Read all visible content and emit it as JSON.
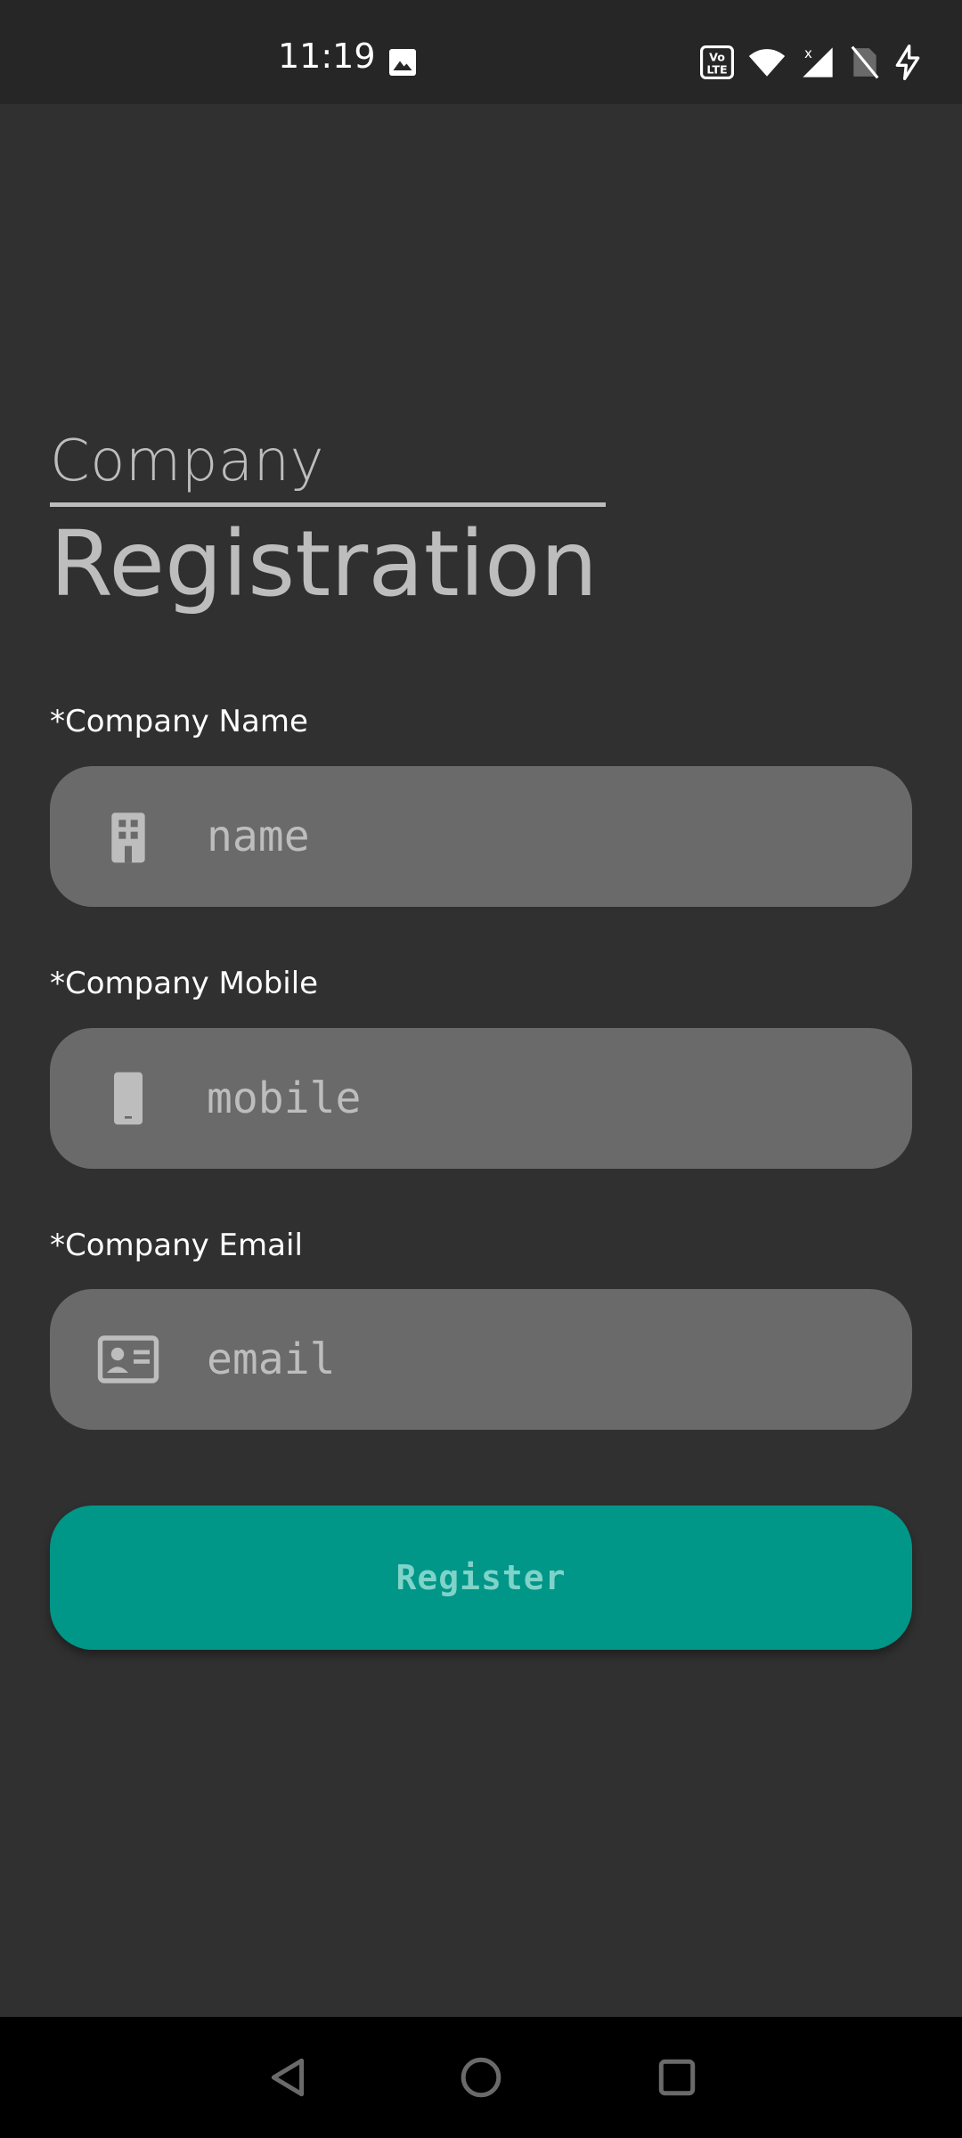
{
  "status_bar": {
    "time": "11:19",
    "icons": [
      "gallery-icon",
      "volte-icon",
      "wifi-icon",
      "signal-icon",
      "no-sim-icon",
      "charging-icon"
    ]
  },
  "header": {
    "title_small": "Company",
    "title_large": "Registration"
  },
  "form": {
    "name": {
      "label": "*Company Name",
      "placeholder": "name",
      "value": "",
      "icon": "building-icon"
    },
    "mobile": {
      "label": "*Company Mobile",
      "placeholder": "mobile",
      "value": "",
      "icon": "phone-icon"
    },
    "email": {
      "label": "*Company Email",
      "placeholder": "email",
      "value": "",
      "icon": "contact-card-icon"
    }
  },
  "register_button": {
    "label": "Register"
  },
  "nav": {
    "items": [
      "back-icon",
      "home-icon",
      "recents-icon"
    ]
  },
  "colors": {
    "background": "#303030",
    "status_bar": "#262626",
    "field": "#6a6a6a",
    "accent": "#009688",
    "button_text": "#7fd3c9",
    "title": "#bdbdbd"
  }
}
